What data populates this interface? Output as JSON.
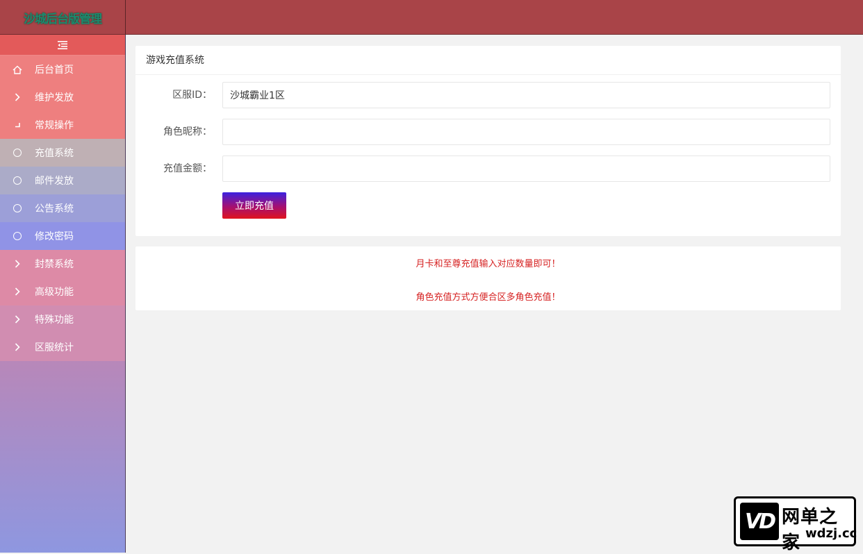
{
  "header": {
    "logo_text": "沙城后台版管理"
  },
  "sidebar": {
    "items": [
      {
        "label": "后台首页",
        "icon": "home-icon"
      },
      {
        "label": "维护发放",
        "icon": "chevron-right-icon"
      },
      {
        "label": "常规操作",
        "icon": "chevron-down-icon"
      },
      {
        "label": "充值系统",
        "icon": "circle-icon"
      },
      {
        "label": "邮件发放",
        "icon": "circle-icon"
      },
      {
        "label": "公告系统",
        "icon": "circle-icon"
      },
      {
        "label": "修改密码",
        "icon": "circle-icon"
      },
      {
        "label": "封禁系统",
        "icon": "chevron-right-icon"
      },
      {
        "label": "高级功能",
        "icon": "chevron-right-icon"
      },
      {
        "label": "特殊功能",
        "icon": "chevron-right-icon"
      },
      {
        "label": "区服统计",
        "icon": "chevron-right-icon"
      }
    ]
  },
  "form": {
    "title": "游戏充值系统",
    "server_label": "区服ID：",
    "server_value": "沙城霸业1区",
    "role_label": "角色昵称：",
    "role_value": "",
    "amount_label": "充值金额：",
    "amount_value": "",
    "submit_label": "立即充值"
  },
  "notices": {
    "line1": "月卡和至尊充值输入对应数量即可！",
    "line2": "角色充值方式方便合区多角色充值！"
  },
  "watermark": {
    "cn": "网单之家",
    "en": "wdzj.cc",
    "mark": "VD"
  },
  "colors": {
    "header": "#a94448",
    "accent_red": "#d62222",
    "logo": "#1d8a6d"
  }
}
